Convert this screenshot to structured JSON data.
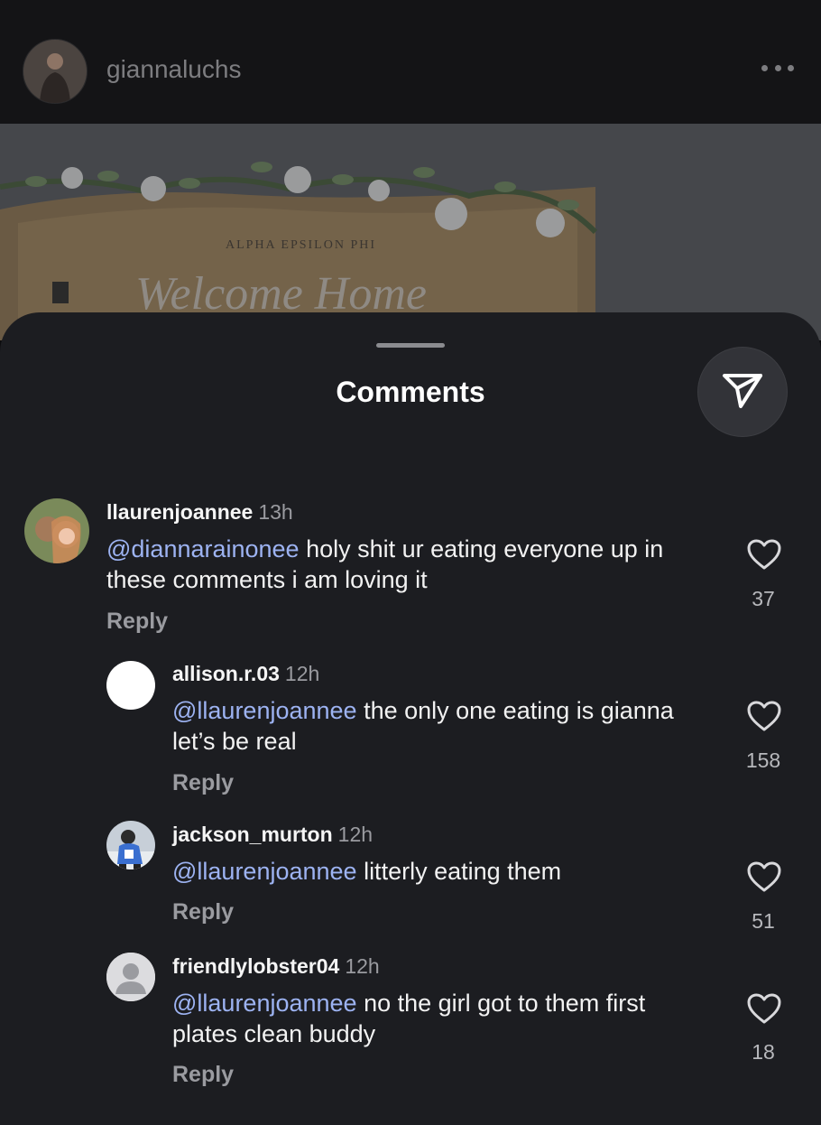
{
  "post": {
    "username": "giannaluchs",
    "more_icon": "more-horizontal-icon",
    "image_text": {
      "org": "ALPHA EPSILON PHI",
      "banner": "Welcome Home"
    }
  },
  "sheet": {
    "title": "Comments",
    "share_icon": "send-icon"
  },
  "comments": [
    {
      "username": "llaurenjoannee",
      "time": "13h",
      "mention": "@diannarainonee",
      "text": " holy shit ur eating everyone up in these comments i am loving it",
      "reply_label": "Reply",
      "likes": "37",
      "avatar": "photo"
    },
    {
      "username": "allison.r.03",
      "time": "12h",
      "mention": "@llaurenjoannee",
      "text": " the only one eating is gianna let’s be real",
      "reply_label": "Reply",
      "likes": "158",
      "avatar": "blank"
    },
    {
      "username": "jackson_murton",
      "time": "12h",
      "mention": "@llaurenjoannee",
      "text": " litterly eating them",
      "reply_label": "Reply",
      "likes": "51",
      "avatar": "photo"
    },
    {
      "username": "friendlylobster04",
      "time": "12h",
      "mention": "@llaurenjoannee",
      "text": " no the girl got to them first plates clean buddy",
      "reply_label": "Reply",
      "likes": "18",
      "avatar": "default-person"
    }
  ],
  "colors": {
    "mention": "#9db3f2",
    "background": "#1c1d21",
    "header": "#141416"
  }
}
